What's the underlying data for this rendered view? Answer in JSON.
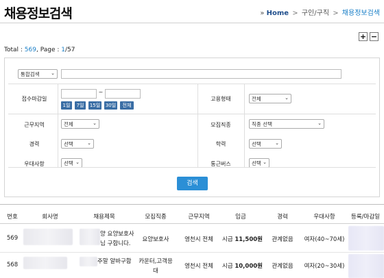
{
  "header": {
    "title": "채용정보검색",
    "breadcrumb": {
      "prefix": "» ",
      "home": "Home",
      "sep1": ">",
      "section": "구인/구직",
      "sep2": ">",
      "current": "채용정보검색"
    }
  },
  "zoom": {
    "plus": "+",
    "minus": "−"
  },
  "summary": {
    "total_label": "Total : ",
    "total": "569",
    "page_label": ", Page : ",
    "page": "1",
    "page_total": "/57"
  },
  "search": {
    "category_select": "통합검색",
    "deadline_label": "접수마감일",
    "date_tilde": "~",
    "date_buttons": [
      "1일",
      "7일",
      "15일",
      "30일",
      "전체"
    ],
    "employment_type_label": "고용형태",
    "employment_type_value": "전체",
    "work_area_label": "근무지역",
    "work_area_value": "전체",
    "job_type_label": "모집직종",
    "job_type_value": "직종 선택",
    "career_label": "경력",
    "career_value": "선택",
    "education_label": "학력",
    "education_value": "선택",
    "preference_label": "우대사항",
    "preference_value": "선택",
    "commute_bus_label": "통근버스",
    "commute_bus_value": "선택",
    "submit": "검색"
  },
  "table": {
    "columns": [
      "번호",
      "회사명",
      "채용제목",
      "모집직종",
      "근무지역",
      "임금",
      "경력",
      "우대사항",
      "등록/마감일"
    ],
    "rows": [
      {
        "no": "569",
        "title_line1": "양 요양보호사",
        "title_line2": "님 구합니다.",
        "job": "요양보호사",
        "area": "영천시 전체",
        "wage_label": "시급",
        "wage_value": "11,500원",
        "career": "관계없음",
        "pref": "여자(40~70세)"
      },
      {
        "no": "568",
        "title_line1": "주말 알바구함",
        "job_line1": "카운터,고객응",
        "job_line2": "대",
        "area": "영천시 전체",
        "wage_label": "시급",
        "wage_value": "10,000원",
        "career": "관계없음",
        "pref": "여자(20~30세)"
      }
    ]
  }
}
